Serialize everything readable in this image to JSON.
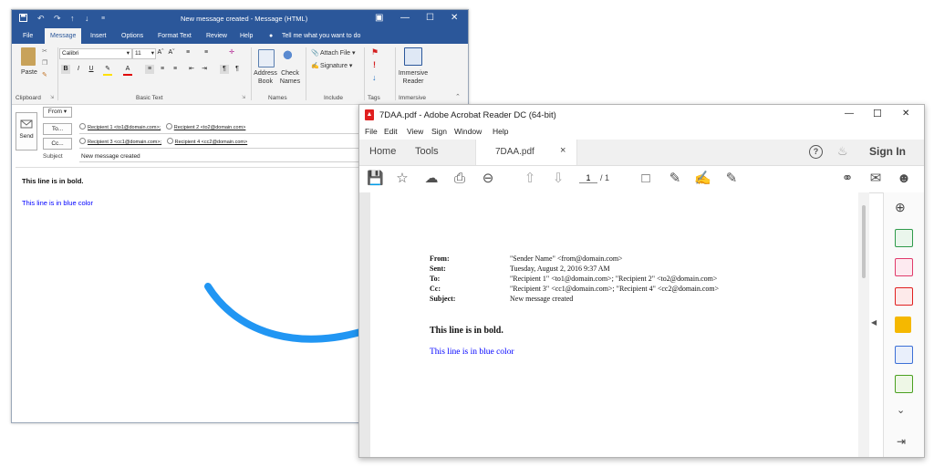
{
  "outlook": {
    "title": "New message created  -  Message (HTML)",
    "quick_access": [
      "💾",
      "↶",
      "↷",
      "↑",
      "↓",
      "≡"
    ],
    "window_controls": [
      "▣",
      "—",
      "☐",
      "✕"
    ],
    "tabs": [
      "File",
      "Message",
      "Insert",
      "Options",
      "Format Text",
      "Review",
      "Help"
    ],
    "tell_me": "Tell me what you want to do",
    "ribbon": {
      "paste": "Paste",
      "clipboard": "Clipboard",
      "font_name": "Calibri",
      "font_size": "11",
      "basic_text": "Basic Text",
      "address_book": "Address Book",
      "check_names": "Check Names",
      "names": "Names",
      "attach_file": "Attach File",
      "signature": "Signature",
      "include": "Include",
      "tags": "Tags",
      "immersive_reader": "Immersive Reader",
      "immersive": "Immersive",
      "format_buttons": [
        "B",
        "I",
        "U"
      ]
    },
    "header": {
      "send": "Send",
      "from": "From ▾",
      "to": "To...",
      "cc": "Cc...",
      "subject_label": "Subject",
      "to_recipients": [
        "Recipient 1 <to1@domain.com>;",
        "Recipient 2 <to2@domain.com>"
      ],
      "cc_recipients": [
        "Recipient 3 <cc1@domain.com>;",
        "Recipient 4 <cc2@domain.com>"
      ],
      "subject_value": "New message created"
    },
    "body": {
      "bold_line": "This line is in bold.",
      "blue_line": "This line is in blue color"
    }
  },
  "acrobat": {
    "title": "7DAA.pdf - Adobe Acrobat Reader DC (64-bit)",
    "window_controls": [
      "—",
      "☐",
      "✕"
    ],
    "menu": [
      "File",
      "Edit",
      "View",
      "Sign",
      "Window",
      "Help"
    ],
    "tabs": {
      "home": "Home",
      "tools": "Tools",
      "doc": "7DAA.pdf",
      "close": "×"
    },
    "sign_in": "Sign In",
    "page_current": "1",
    "page_total": "/  1",
    "pdf": {
      "from_label": "From:",
      "sent_label": "Sent:",
      "to_label": "To:",
      "cc_label": "Cc:",
      "subject_label": "Subject:",
      "from_value": "\"Sender Name\" <from@domain.com>",
      "sent_value": "Tuesday, August 2, 2016 9:37 AM",
      "to_value": "\"Recipient 1\" <to1@domain.com>; \"Recipient 2\" <to2@domain.com>",
      "cc_value": "\"Recipient 3\" <cc1@domain.com>; \"Recipient 4\" <cc2@domain.com>",
      "subject_value": "New message created",
      "bold_line": "This line is in bold.",
      "blue_line": "This line is in blue color"
    }
  },
  "colors": {
    "outlook_blue": "#2b579a",
    "body_blue": "#0000ff",
    "arrow_blue": "#2196f3"
  }
}
